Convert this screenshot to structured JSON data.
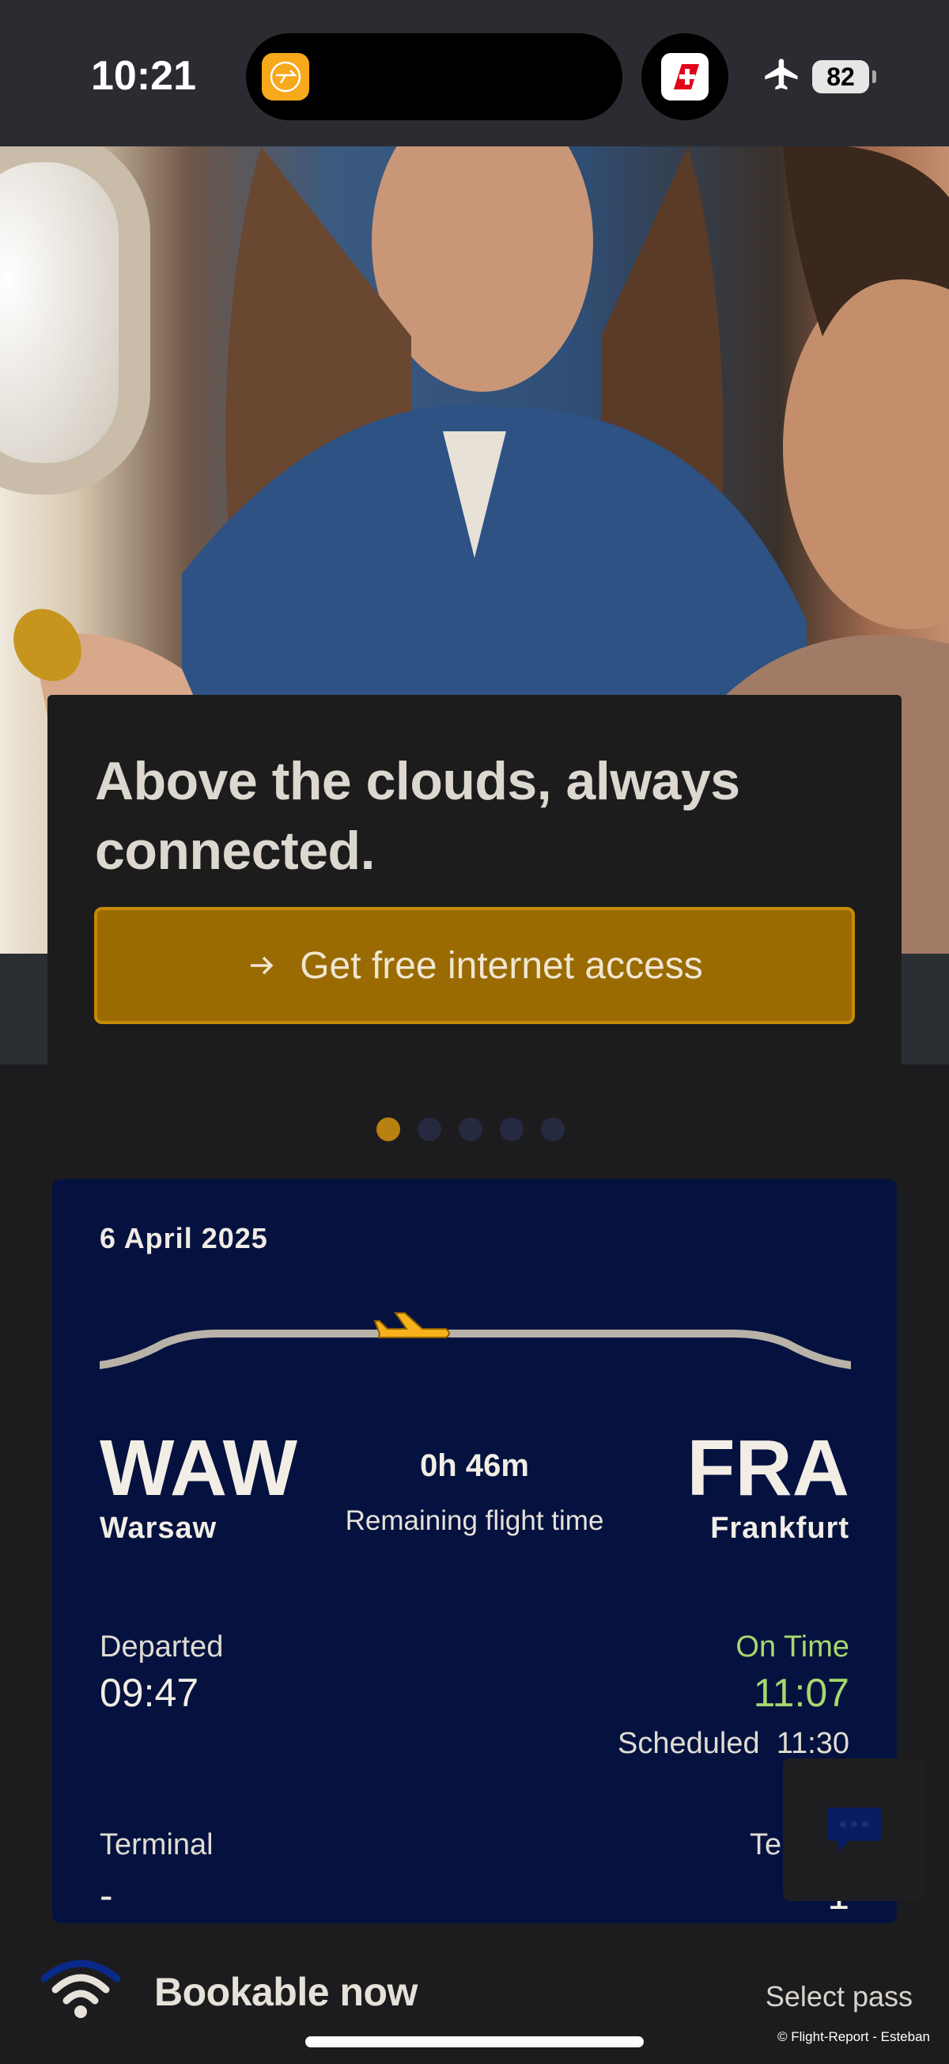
{
  "status_bar": {
    "time": "10:21",
    "battery": "82",
    "airplane_mode": "airplane-icon"
  },
  "promo": {
    "title": "Above the clouds, always connected.",
    "cta_label": "Get free internet access",
    "cta_icon": "arrow-right-icon",
    "carousel": {
      "count": 5,
      "active_index": 0
    }
  },
  "flight": {
    "date": "6 April 2025",
    "origin": {
      "code": "WAW",
      "city": "Warsaw"
    },
    "destination": {
      "code": "FRA",
      "city": "Frankfurt"
    },
    "remaining_time": "0h 46m",
    "remaining_label": "Remaining flight time",
    "departure": {
      "label": "Departed",
      "time": "09:47"
    },
    "arrival": {
      "status": "On Time",
      "time": "11:07",
      "scheduled": "Scheduled  11:30"
    },
    "terminal_left": {
      "label": "Terminal",
      "value": "-"
    },
    "terminal_right": {
      "label": "Ter",
      "value": "1"
    },
    "progress_fraction": 0.42
  },
  "bottom": {
    "label": "Bookable now",
    "action": "Select pass",
    "credit": "© Flight-Report - Esteban"
  },
  "colors": {
    "accent": "#9a6b03",
    "card": "#05123f",
    "status_green": "#a6d86f"
  }
}
